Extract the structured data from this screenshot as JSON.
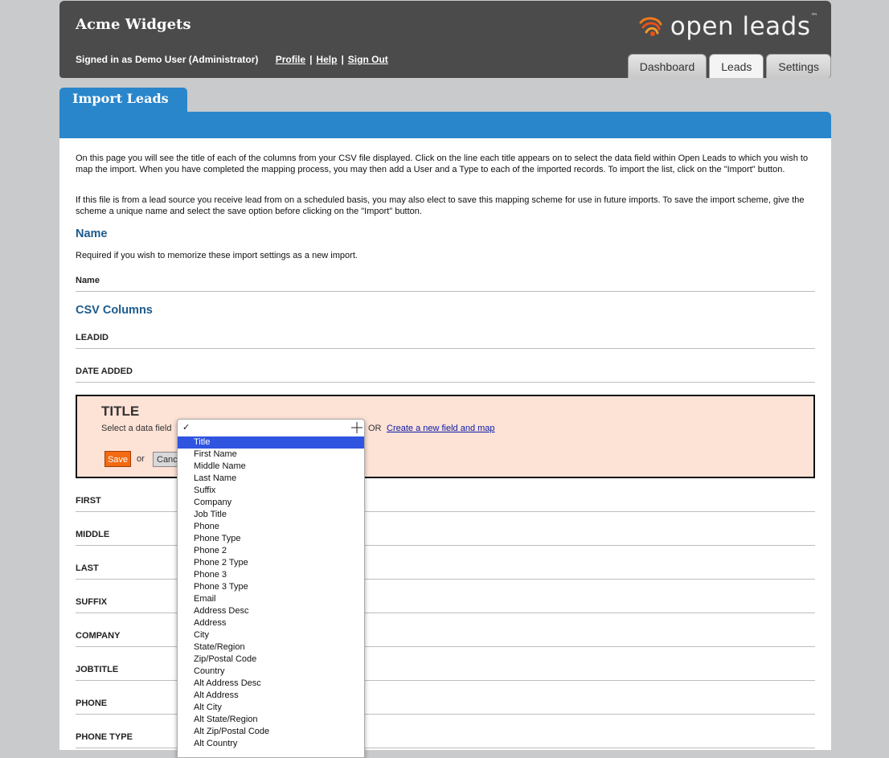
{
  "header": {
    "company": "Acme Widgets",
    "signed_in": "Signed in as Demo User (Administrator)",
    "links": [
      "Profile",
      "Help",
      "Sign Out"
    ],
    "logo_text": "open leads",
    "logo_tm": "™",
    "tabs": [
      {
        "label": "Dashboard",
        "active": false
      },
      {
        "label": "Leads",
        "active": true
      },
      {
        "label": "Settings",
        "active": false
      }
    ]
  },
  "page": {
    "title": "Import Leads",
    "intro_1": "On this page you will see the title of each of the columns from your CSV file displayed. Click on the line each title appears on to select the data field within Open Leads to which you wish to map the import. When you have completed the mapping process, you may then add a User and a Type to each of the imported records. To import the list, click on the \"Import\" button.",
    "intro_2": "If this file is from a lead source you receive lead from on a scheduled basis, you may also elect to save this mapping scheme for use in future imports. To save the import scheme, give the scheme a unique name and select the save option before clicking on the \"Import\" button."
  },
  "name_section": {
    "title": "Name",
    "help": "Required if you wish to memorize these import settings as a new import.",
    "field_label": "Name"
  },
  "csv_section": {
    "title": "CSV Columns",
    "rows_before": [
      "LEADID",
      "DATE ADDED"
    ],
    "rows_after": [
      "FIRST",
      "MIDDLE",
      "LAST",
      "SUFFIX",
      "COMPANY",
      "JOBTITLE",
      "PHONE",
      "PHONE TYPE"
    ]
  },
  "editor": {
    "column": "TITLE",
    "prompt": "Select a data field",
    "or": "OR",
    "create_link": "Create a new field and map",
    "save": "Save",
    "or2": "or",
    "cancel": "Canc"
  },
  "dropdown": {
    "check": "✓",
    "selected": "Title",
    "options": [
      "Title",
      "First Name",
      "Middle Name",
      "Last Name",
      "Suffix",
      "Company",
      "Job Title",
      "Phone",
      "Phone Type",
      "Phone 2",
      "Phone 2 Type",
      "Phone 3",
      "Phone 3 Type",
      "Email",
      "Address Desc",
      "Address",
      "City",
      "State/Region",
      "Zip/Postal Code",
      "Country",
      "Alt Address Desc",
      "Alt Address",
      "Alt City",
      "Alt State/Region",
      "Alt Zip/Postal Code",
      "Alt Country"
    ]
  },
  "colors": {
    "header_bg": "#4b4b4b",
    "accent_blue": "#2a86cb",
    "section_title": "#1d5b8c",
    "editor_bg": "#fde2d6",
    "save_orange": "#f26a12",
    "selected_option": "#2f54e0"
  }
}
